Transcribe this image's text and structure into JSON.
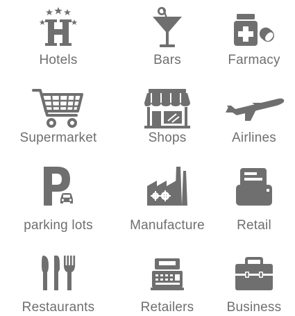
{
  "colors": {
    "icon": "#6f6f6f",
    "label": "#6f6f6f",
    "background": "#ffffff"
  },
  "categories": [
    {
      "label": "Hotels",
      "icon": "hotel-icon"
    },
    {
      "label": "Bars",
      "icon": "cocktail-icon"
    },
    {
      "label": "Farmacy",
      "icon": "pills-icon"
    },
    {
      "label": "Supermarket",
      "icon": "shopping-cart-icon"
    },
    {
      "label": "Shops",
      "icon": "storefront-icon"
    },
    {
      "label": "Airlines",
      "icon": "airplane-icon"
    },
    {
      "label": "parking lots",
      "icon": "parking-icon"
    },
    {
      "label": "Manufacture",
      "icon": "factory-icon"
    },
    {
      "label": "Retail",
      "icon": "printer-icon"
    },
    {
      "label": "Restaurants",
      "icon": "cutlery-icon"
    },
    {
      "label": "Retailers",
      "icon": "cash-register-icon"
    },
    {
      "label": "Business",
      "icon": "briefcase-icon"
    }
  ]
}
